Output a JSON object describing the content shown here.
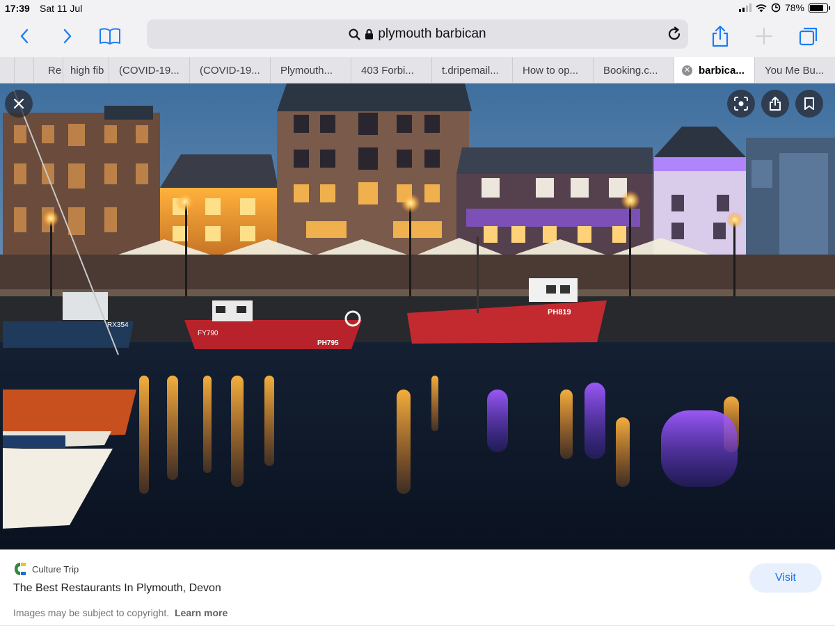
{
  "status": {
    "time": "17:39",
    "date": "Sat 11 Jul",
    "battery": "78%",
    "battery_level": 0.78
  },
  "toolbar": {
    "address": "plymouth barbican",
    "accent": "#1a7df5",
    "icons": [
      "chevron-left-icon",
      "chevron-right-icon",
      "book-icon",
      "search-icon",
      "lock-icon",
      "reload-icon",
      "share-icon",
      "plus-icon",
      "tabs-icon"
    ]
  },
  "tabs": [
    {
      "label": "Re"
    },
    {
      "label": "high fib"
    },
    {
      "label": "(COVID-19..."
    },
    {
      "label": "(COVID-19..."
    },
    {
      "label": "Plymouth..."
    },
    {
      "label": "403 Forbi..."
    },
    {
      "label": "t.dripemail..."
    },
    {
      "label": "How to op..."
    },
    {
      "label": "Booking.c..."
    },
    {
      "label": "barbica...",
      "active": true
    },
    {
      "label": "You Me Bu..."
    }
  ],
  "image": {
    "boat_numbers": [
      "RX354",
      "FY790",
      "PH795",
      "PH819"
    ],
    "overlay_icons": [
      "close-icon",
      "lens-icon",
      "share-icon",
      "bookmark-icon"
    ]
  },
  "result": {
    "source": "Culture Trip",
    "title": "The Best Restaurants In Plymouth, Devon",
    "copyright": "Images may be subject to copyright.",
    "learn_more": "Learn more",
    "visit": "Visit",
    "accent": "#1a73e8"
  }
}
